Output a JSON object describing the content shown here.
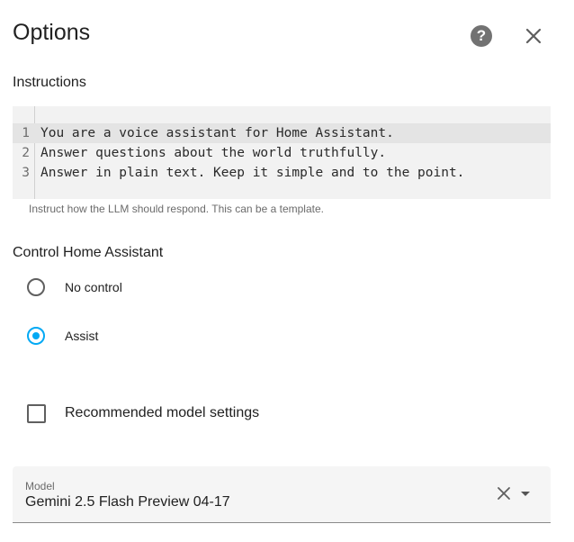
{
  "dialog": {
    "title": "Options",
    "help_icon": "help-circle-icon",
    "close_icon": "close-icon"
  },
  "instructions": {
    "label": "Instructions",
    "lines": [
      {
        "number": "1",
        "text": "You are a voice assistant for Home Assistant."
      },
      {
        "number": "2",
        "text": "Answer questions about the world truthfully."
      },
      {
        "number": "3",
        "text": "Answer in plain text. Keep it simple and to the point."
      }
    ],
    "hint": "Instruct how the LLM should respond. This can be a template."
  },
  "control": {
    "label": "Control Home Assistant",
    "options": [
      {
        "label": "No control",
        "checked": false
      },
      {
        "label": "Assist",
        "checked": true
      }
    ]
  },
  "recommended": {
    "label": "Recommended model settings",
    "checked": false
  },
  "model": {
    "label": "Model",
    "value": "Gemini 2.5 Flash Preview 04-17",
    "clear_icon": "clear-icon",
    "dropdown_icon": "caret-down-icon"
  },
  "colors": {
    "accent": "#03a9f4"
  }
}
